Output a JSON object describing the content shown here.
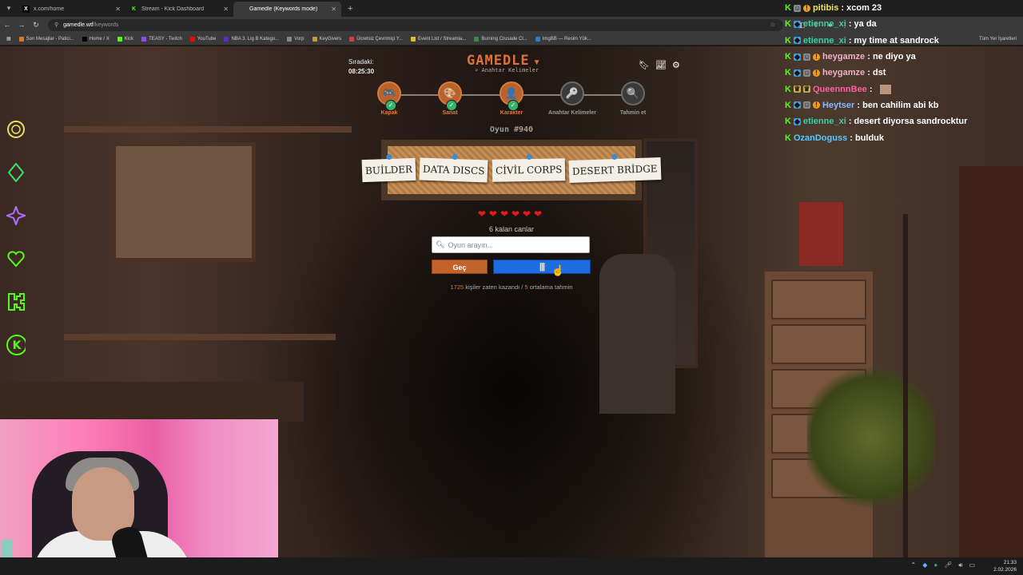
{
  "browser": {
    "tabs": [
      {
        "title": "x.com/home",
        "fav": "X",
        "color": "#000000",
        "fg": "#ffffff",
        "active": false
      },
      {
        "title": "Stream - Kick Dashboard",
        "fav": "K",
        "color": "#1a1a1a",
        "fg": "#53fc18",
        "active": false
      },
      {
        "title": "Gamedle (Keywords mode)",
        "fav": "",
        "color": "#3a3a3a",
        "fg": "#ffffff",
        "active": true
      }
    ],
    "url_host": "gamedle.wtf",
    "url_path": "/keywords",
    "bookmarks": [
      {
        "label": "Son Mesajlar - Patici...",
        "color": "#d8782a"
      },
      {
        "label": "Home / X",
        "color": "#000000"
      },
      {
        "label": "Kick",
        "color": "#53fc18"
      },
      {
        "label": "TEASY - Twitch",
        "color": "#9146ff"
      },
      {
        "label": "YouTube",
        "color": "#ff0000"
      },
      {
        "label": "NBA 3. Lig B Katego...",
        "color": "#5a2ad8"
      },
      {
        "label": "Vorp",
        "color": "#888888"
      },
      {
        "label": "KeyGivers",
        "color": "#c49a42"
      },
      {
        "label": "Ücretsiz Çevrimiçi Y...",
        "color": "#d04040"
      },
      {
        "label": "Event List / Streamla...",
        "color": "#e0c030"
      },
      {
        "label": "Burning Crusade Cl...",
        "color": "#3a8a4a"
      },
      {
        "label": "ImgBB — Resim Yük...",
        "color": "#2a7ad8"
      }
    ],
    "all_bookmarks": "Tüm Yer İşaretleri"
  },
  "game": {
    "next_label": "Sıradaki:",
    "next_time": "08:25:30",
    "logo": "GAMEDLE",
    "mode": "Anahtar Kelimeler",
    "steps": [
      {
        "label": "Kapak",
        "icon": "🎮",
        "done": true
      },
      {
        "label": "Sanat",
        "icon": "🎨",
        "done": true
      },
      {
        "label": "Karakter",
        "icon": "👤",
        "done": true
      },
      {
        "label": "Anahtar Kelimeler",
        "icon": "🔑",
        "done": false
      },
      {
        "label": "Tahmin et",
        "icon": "🔍",
        "done": false
      }
    ],
    "game_prefix": "Oyun ",
    "game_number": "#940",
    "keywords": [
      "BUİLDER",
      "DATA DISCS",
      "CİVİL CORPS",
      "DESERT BRİDGE"
    ],
    "hearts": "❤❤❤❤❤❤",
    "lives_remaining": "6 kalan canlar",
    "search_placeholder": "Oyun arayın...",
    "skip_label": "Geç",
    "guess_label": "|||",
    "stats_winners": "1725",
    "stats_mid": " kişiler zaten kazandı / ",
    "stats_avg": "5",
    "stats_tail": " ortalama tahmin"
  },
  "chat": [
    {
      "user": "pitibis",
      "user_color": "#f0e060",
      "text": "xcom 23",
      "badges": [
        "k",
        "gray",
        "orange"
      ]
    },
    {
      "user": "etienne_xi",
      "user_color": "#3ad0a0",
      "text": "ya da",
      "badges": [
        "k",
        "blue"
      ]
    },
    {
      "user": "etienne_xi",
      "user_color": "#3ad0a0",
      "text": "my time at sandrock",
      "badges": [
        "k",
        "blue"
      ]
    },
    {
      "user": "heygamze",
      "user_color": "#f0b0c8",
      "text": "ne diyo ya",
      "badges": [
        "k",
        "blue",
        "gray",
        "orange"
      ]
    },
    {
      "user": "heygamze",
      "user_color": "#f0b0c8",
      "text": "dst",
      "badges": [
        "k",
        "blue",
        "gray",
        "orange"
      ]
    },
    {
      "user": "QueennnBee",
      "user_color": "#ff5fa0",
      "text": "",
      "badges": [
        "k",
        "gold",
        "gold"
      ],
      "avatar": true
    },
    {
      "user": "Heytser",
      "user_color": "#8ab8ff",
      "text": "ben cahilim abi kb",
      "badges": [
        "k",
        "blue",
        "gray",
        "orange"
      ]
    },
    {
      "user": "etienne_xi",
      "user_color": "#3ad0a0",
      "text": "desert diyorsa sandrocktur",
      "badges": [
        "k",
        "blue"
      ]
    },
    {
      "user": "OzanDoguss",
      "user_color": "#58c8ff",
      "text": "bulduk",
      "badges": [
        "k"
      ]
    }
  ],
  "taskbar": {
    "time": "21:33",
    "date": "2.02.2026"
  },
  "colors": {
    "accent": "#e0703a",
    "guess_button": "#1c6ee0",
    "kick_green": "#53fc18"
  }
}
